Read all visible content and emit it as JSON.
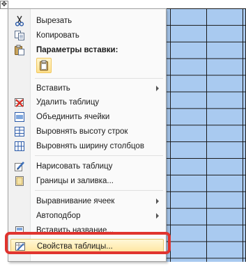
{
  "menu": {
    "items": [
      {
        "id": "cut",
        "label": "Вырезать",
        "icon": "scissors-icon"
      },
      {
        "id": "copy",
        "label": "Копировать",
        "icon": "copy-icon"
      },
      {
        "id": "paste-header",
        "label": "Параметры вставки:",
        "icon": "paste-clipboard-icon"
      },
      {
        "id": "insert",
        "label": "Вставить",
        "icon": "",
        "submenu": true
      },
      {
        "id": "delete-table",
        "label": "Удалить таблицу",
        "icon": "delete-table-icon"
      },
      {
        "id": "merge-cells",
        "label": "Объединить ячейки",
        "icon": "merge-cells-icon"
      },
      {
        "id": "distribute-rows",
        "label": "Выровнять высоту строк",
        "icon": "distribute-rows-icon"
      },
      {
        "id": "distribute-cols",
        "label": "Выровнять ширину столбцов",
        "icon": "distribute-columns-icon"
      },
      {
        "id": "draw-table",
        "label": "Нарисовать таблицу",
        "icon": "pencil-icon"
      },
      {
        "id": "borders-shading",
        "label": "Границы и заливка...",
        "icon": "borders-icon"
      },
      {
        "id": "cell-alignment",
        "label": "Выравнивание ячеек",
        "icon": "",
        "submenu": true
      },
      {
        "id": "autofit",
        "label": "Автоподбор",
        "icon": "",
        "submenu": true
      },
      {
        "id": "insert-caption",
        "label": "Вставить название...",
        "icon": "caption-icon"
      },
      {
        "id": "table-properties",
        "label": "Свойства таблицы...",
        "icon": "table-properties-icon",
        "highlighted": true
      }
    ]
  },
  "colors": {
    "table_fill": "#a9caf0",
    "highlight_frame": "#e0342f",
    "hover_fill": "#ffe49a"
  }
}
